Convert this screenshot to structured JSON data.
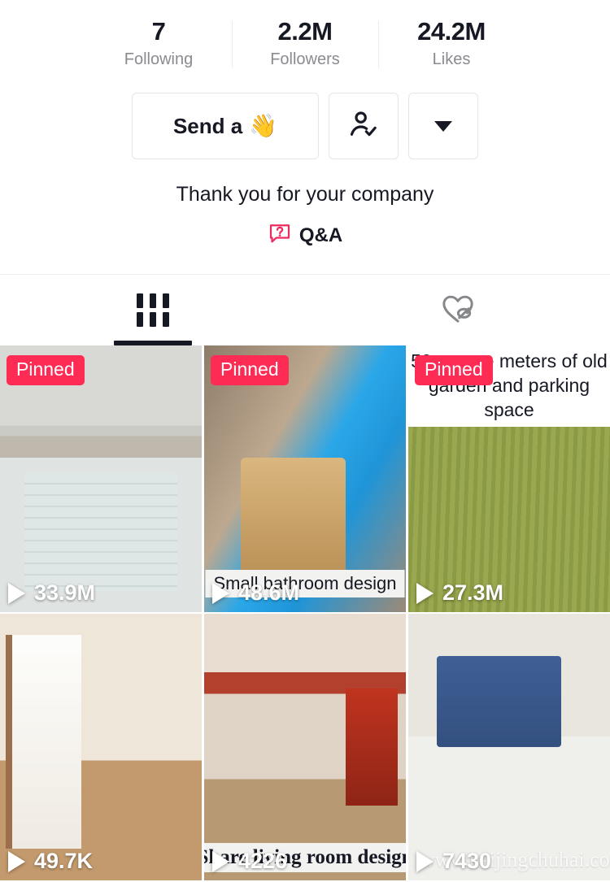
{
  "profile": {
    "stats": [
      {
        "value": "7",
        "label": "Following",
        "name": "following"
      },
      {
        "value": "2.2M",
        "label": "Followers",
        "name": "followers"
      },
      {
        "value": "24.2M",
        "label": "Likes",
        "name": "likes"
      }
    ],
    "actions": {
      "primary_label": "Send a",
      "primary_emoji": "👋",
      "follow_icon": "person-check-icon",
      "more_icon": "chevron-down-icon"
    },
    "bio": "Thank you for your company",
    "qa_label": "Q&A",
    "qa_icon": "question-bubble-icon"
  },
  "tabs": [
    {
      "name": "videos",
      "icon": "grid-icon",
      "active": true
    },
    {
      "name": "liked",
      "icon": "heart-slash-icon",
      "active": false
    }
  ],
  "videos": [
    {
      "views": "33.9M",
      "pinned_label": "Pinned",
      "pinned": true,
      "caption": "",
      "caption_position": "",
      "art": "t1",
      "alt": "loft bed bedroom interior"
    },
    {
      "views": "48.6M",
      "pinned_label": "Pinned",
      "pinned": true,
      "caption": "Small bathroom design",
      "caption_position": "bottom",
      "art": "t2",
      "alt": "small bathroom wooden tub"
    },
    {
      "views": "27.3M",
      "pinned_label": "Pinned",
      "pinned": true,
      "caption": "50 square meters of old garden and parking space",
      "caption_position": "top",
      "art": "t3",
      "alt": "overgrown garden parking space"
    },
    {
      "views": "49.7K",
      "pinned_label": "",
      "pinned": false,
      "caption": "",
      "caption_position": "",
      "art": "t4",
      "alt": "3d rendered bedroom with figure"
    },
    {
      "views": "4226",
      "pinned_label": "",
      "pinned": false,
      "caption": "Share living room design",
      "caption_position": "bottom-serif",
      "art": "t5",
      "alt": "modern chinese living room"
    },
    {
      "views": "7430",
      "pinned_label": "",
      "pinned": false,
      "caption": "",
      "caption_position": "",
      "watermark": "www.haijingchuhai.com",
      "art": "t6",
      "alt": "two people sitting on blue sofa"
    }
  ],
  "colors": {
    "accent_pink": "#fe2c55",
    "text_primary": "#161823",
    "text_secondary": "#8a8b91"
  }
}
